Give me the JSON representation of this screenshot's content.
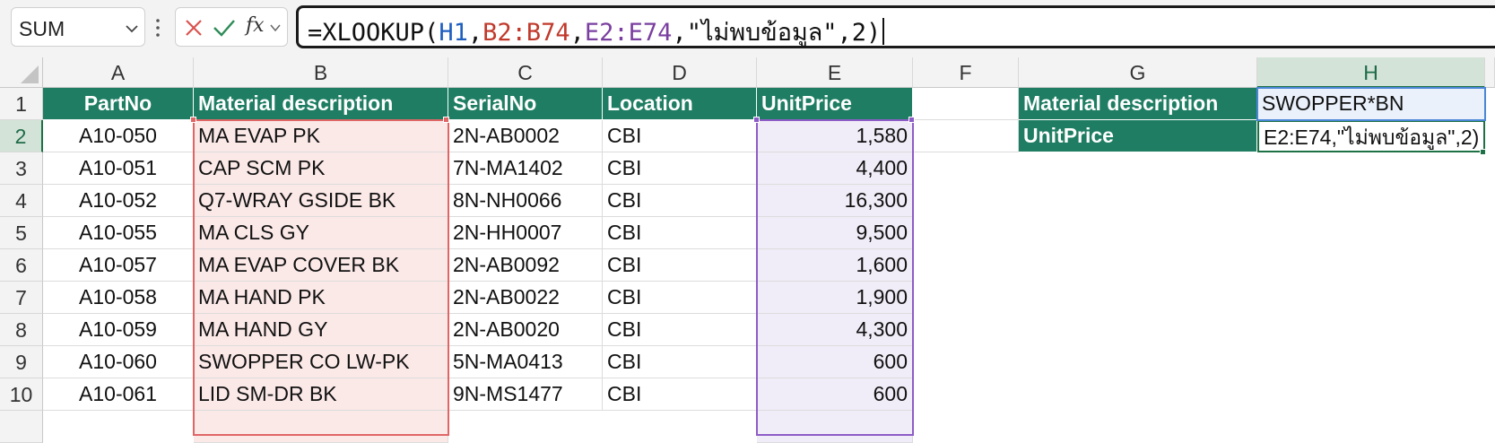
{
  "formula_bar": {
    "name_box": "SUM",
    "fx_label": "fx",
    "formula_parts": {
      "p1": "=XLOOKUP(",
      "r1": "H1",
      "s1": ",",
      "r2": "B2:B74",
      "s2": ",",
      "r3": "E2:E74",
      "p2": ",\"ไม่พบข้อมูล\",2)"
    },
    "icons": {
      "dropdown": "chevron-down-icon",
      "more": "vertical-dots-icon",
      "cancel": "x-mark-icon",
      "enter": "check-mark-icon",
      "function": "fx-icon"
    }
  },
  "columns": [
    "A",
    "B",
    "C",
    "D",
    "E",
    "F",
    "G",
    "H"
  ],
  "rows": [
    "1",
    "2",
    "3",
    "4",
    "5",
    "6",
    "7",
    "8",
    "9",
    "10"
  ],
  "table": {
    "headers": [
      "PartNo",
      "Material description",
      "SerialNo",
      "Location",
      "UnitPrice"
    ],
    "data": [
      [
        "A10-050",
        "MA EVAP PK",
        "2N-AB0002",
        "CBI",
        "1,580"
      ],
      [
        "A10-051",
        "CAP SCM PK",
        "7N-MA1402",
        "CBI",
        "4,400"
      ],
      [
        "A10-052",
        "Q7-WRAY GSIDE BK",
        "8N-NH0066",
        "CBI",
        "16,300"
      ],
      [
        "A10-055",
        "MA CLS GY",
        "2N-HH0007",
        "CBI",
        "9,500"
      ],
      [
        "A10-057",
        "MA EVAP COVER BK",
        "2N-AB0092",
        "CBI",
        "1,600"
      ],
      [
        "A10-058",
        "MA HAND PK",
        "2N-AB0022",
        "CBI",
        "1,900"
      ],
      [
        "A10-059",
        "MA HAND GY",
        "2N-AB0020",
        "CBI",
        "4,300"
      ],
      [
        "A10-060",
        "SWOPPER CO LW-PK",
        "5N-MA0413",
        "CBI",
        "600"
      ],
      [
        "A10-061",
        "LID SM-DR BK",
        "9N-MS1477",
        "CBI",
        "600"
      ]
    ]
  },
  "lookup": {
    "g1": "Material description",
    "h1": "SWOPPER*BN",
    "g2": "UnitPrice",
    "h2": "E2:E74,\"ไม่พบข้อมูล\",2)"
  },
  "colors": {
    "header_fill": "#1e7d62",
    "ref_h1": "#1f5fbf",
    "ref_b": "#c0392b",
    "ref_e": "#7a3fa0",
    "selection": "#1e7145"
  }
}
